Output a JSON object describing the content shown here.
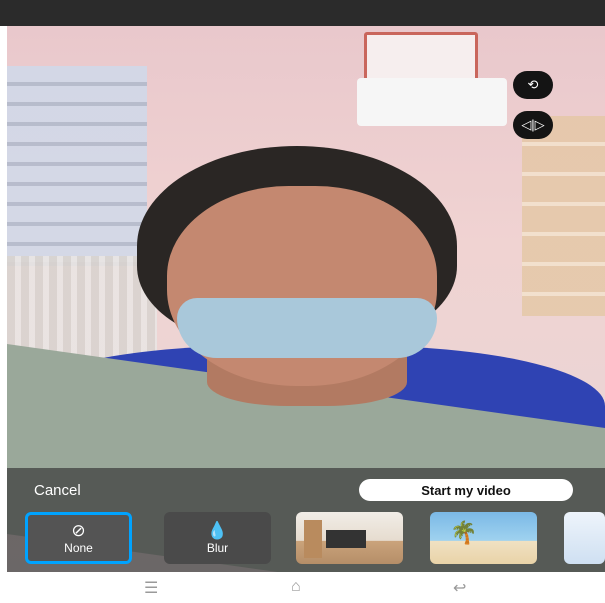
{
  "camera_controls": {
    "switch_camera_icon": "camera-switch-icon",
    "mirror_icon": "mirror-flip-icon"
  },
  "panel": {
    "cancel_label": "Cancel",
    "start_label": "Start my video"
  },
  "effects": [
    {
      "label": "None",
      "icon": "none-icon"
    },
    {
      "label": "Blur",
      "icon": "blur-icon"
    }
  ],
  "background_options": [
    {
      "name": "room",
      "icon": "room-background-thumbnail"
    },
    {
      "name": "beach",
      "icon": "beach-background-thumbnail"
    },
    {
      "name": "partial",
      "icon": "background-thumbnail"
    }
  ],
  "navigation": {
    "menu_icon": "menu-icon",
    "home_icon": "home-icon",
    "back_icon": "back-icon"
  },
  "colors": {
    "selected_outline": "#00a3ff",
    "panel_bg": "#3c3c3c"
  }
}
